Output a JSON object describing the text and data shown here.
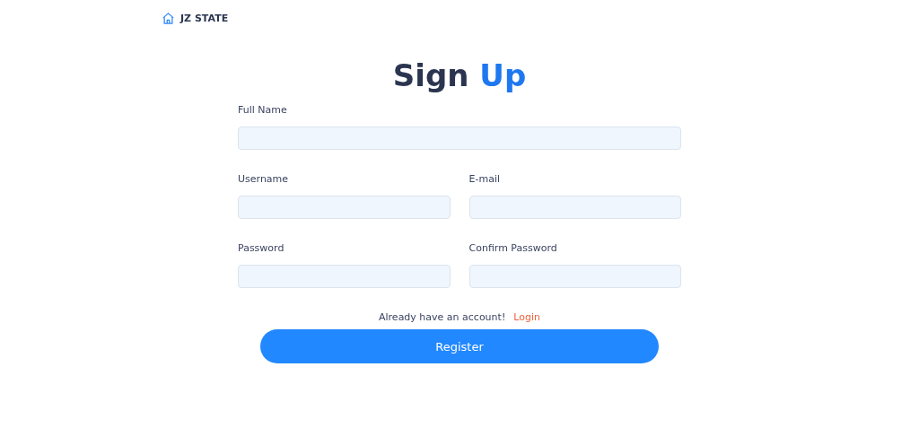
{
  "brand": {
    "name": "JZ STATE"
  },
  "title": {
    "text": "Sign",
    "accent": "Up"
  },
  "form_rows": [
    {
      "fields": [
        {
          "label": "Full Name"
        }
      ]
    },
    {
      "fields": [
        {
          "label": "Username"
        },
        {
          "label": "E-mail"
        }
      ]
    },
    {
      "fields": [
        {
          "label": "Password"
        },
        {
          "label": "Confirm Password"
        }
      ]
    }
  ],
  "login_prompt": {
    "text": "Already have an account!",
    "link": "Login"
  },
  "submit_button": "Register"
}
